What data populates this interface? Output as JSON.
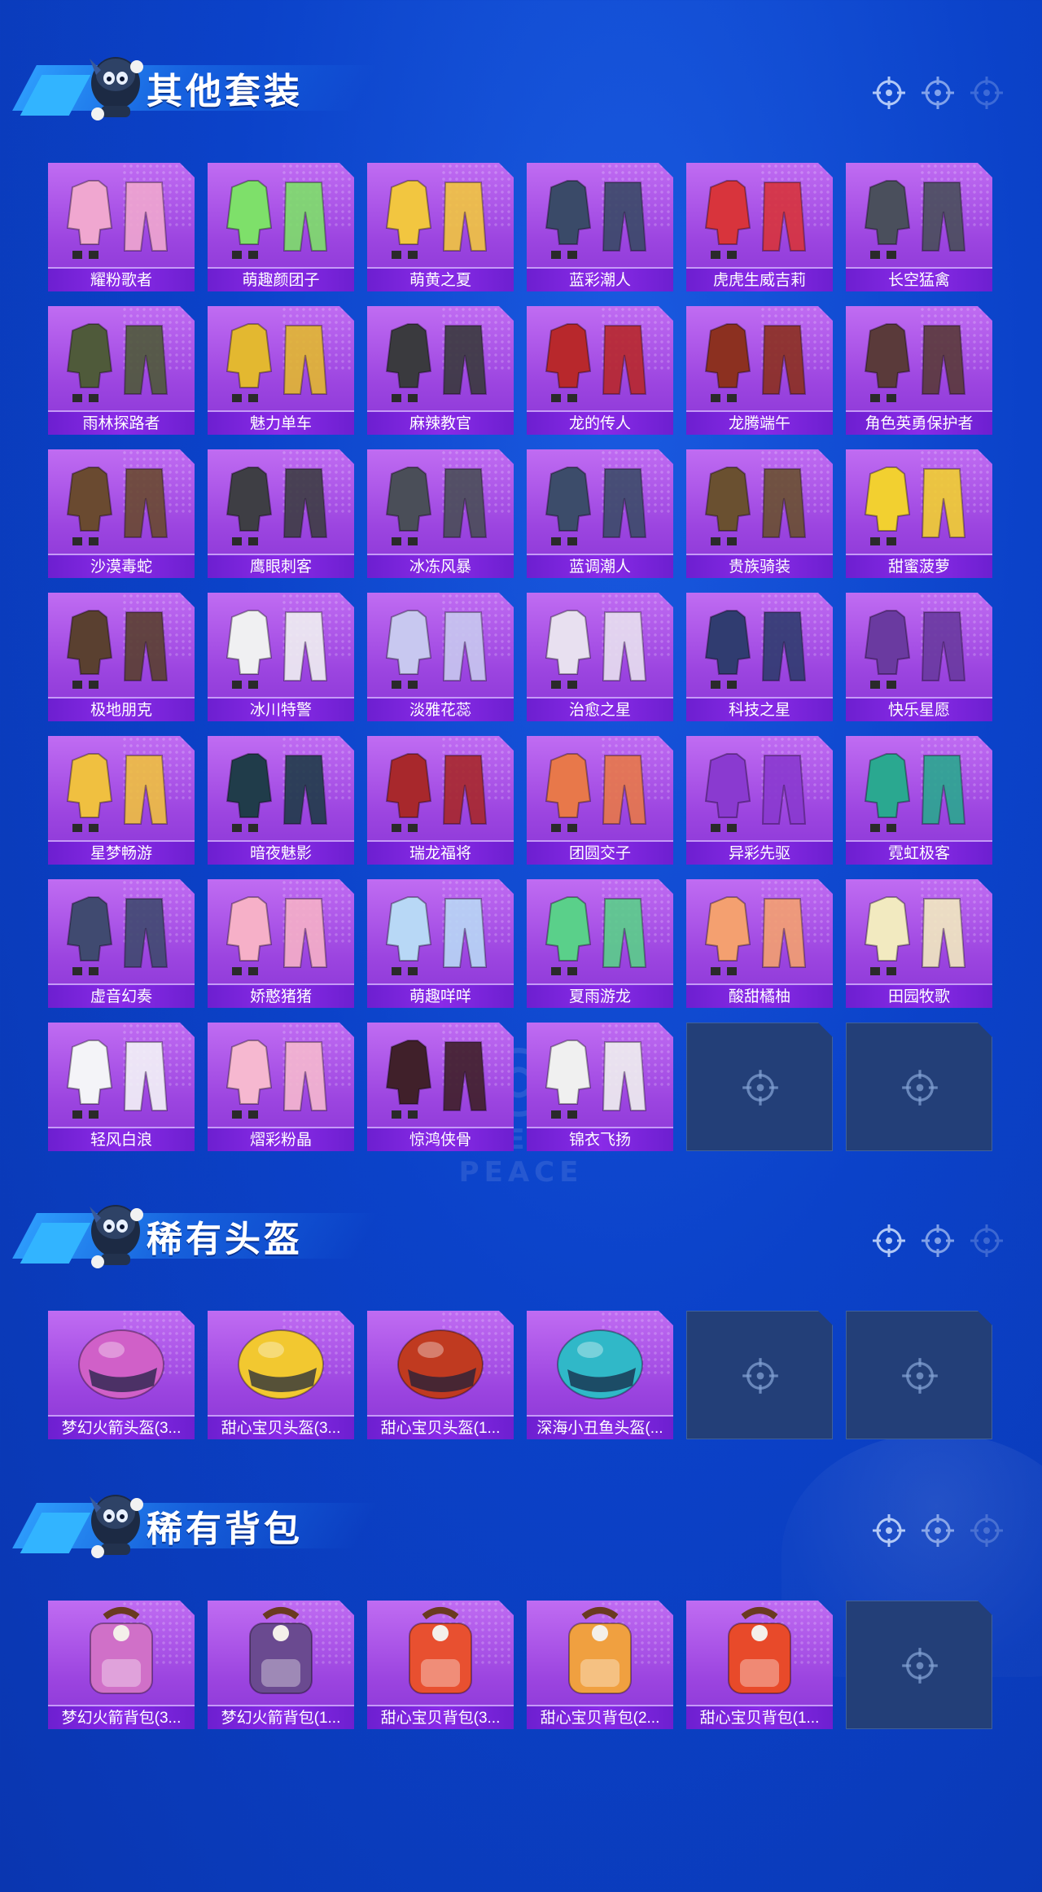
{
  "sections": [
    {
      "title": "其他套装",
      "slots": 42,
      "items": [
        "耀粉歌者",
        "萌趣颜团子",
        "萌黄之夏",
        "蓝彩潮人",
        "虎虎生威吉莉",
        "长空猛禽",
        "雨林探路者",
        "魅力单车",
        "麻辣教官",
        "龙的传人",
        "龙腾端午",
        "角色英勇保护者",
        "沙漠毒蛇",
        "鹰眼刺客",
        "冰冻风暴",
        "蓝调潮人",
        "贵族骑装",
        "甜蜜菠萝",
        "极地朋克",
        "冰川特警",
        "淡雅花蕊",
        "治愈之星",
        "科技之星",
        "快乐星愿",
        "星梦畅游",
        "暗夜魅影",
        "瑞龙福将",
        "团圆交子",
        "异彩先驱",
        "霓虹极客",
        "虚音幻奏",
        "娇憨猪猪",
        "萌趣咩咩",
        "夏雨游龙",
        "酸甜橘柚",
        "田园牧歌",
        "轻风白浪",
        "熠彩粉晶",
        "惊鸿侠骨",
        "锦衣飞扬"
      ],
      "colors": [
        "#f0a7d0",
        "#7ee06a",
        "#f2c640",
        "#3a4a68",
        "#d8343c",
        "#4a4f5c",
        "#4f5a3a",
        "#e3b830",
        "#3a3a3e",
        "#b8282c",
        "#8c3020",
        "#5a3a3a",
        "#6a4a30",
        "#3e3e44",
        "#4a4e58",
        "#3c4c6a",
        "#6a5030",
        "#f2d030",
        "#5a4030",
        "#f0f0f2",
        "#c8c8f0",
        "#e8e0f0",
        "#303c70",
        "#6a3aa0",
        "#f0c040",
        "#203c4a",
        "#a8282c",
        "#e8784a",
        "#8a3ad0",
        "#2aa890",
        "#404a70",
        "#f6b0c8",
        "#b8d8f6",
        "#5ad08a",
        "#f4a070",
        "#f2eac0",
        "#f4f4f8",
        "#f6b8d0",
        "#40202a",
        "#f0f0f0"
      ]
    },
    {
      "title": "稀有头盔",
      "slots": 6,
      "items": [
        "梦幻火箭头盔(3...",
        "甜心宝贝头盔(3...",
        "甜心宝贝头盔(1...",
        "深海小丑鱼头盔(..."
      ],
      "colors": [
        "#d060c8",
        "#f2c830",
        "#c03a20",
        "#30b8c8"
      ]
    },
    {
      "title": "稀有背包",
      "slots": 6,
      "items": [
        "梦幻火箭背包(3...",
        "梦幻火箭背包(1...",
        "甜心宝贝背包(3...",
        "甜心宝贝背包(2...",
        "甜心宝贝背包(1..."
      ],
      "colors": [
        "#d070c8",
        "#6a4a90",
        "#e85030",
        "#f0a040",
        "#e84a2a"
      ]
    }
  ],
  "background_watermark": "GAME FOR PEACE",
  "accent": "#8a2be8",
  "empty_slot_color": "#233f78",
  "icons": {
    "mascot": "mascot-icon",
    "crosshair": "crosshair-icon"
  }
}
